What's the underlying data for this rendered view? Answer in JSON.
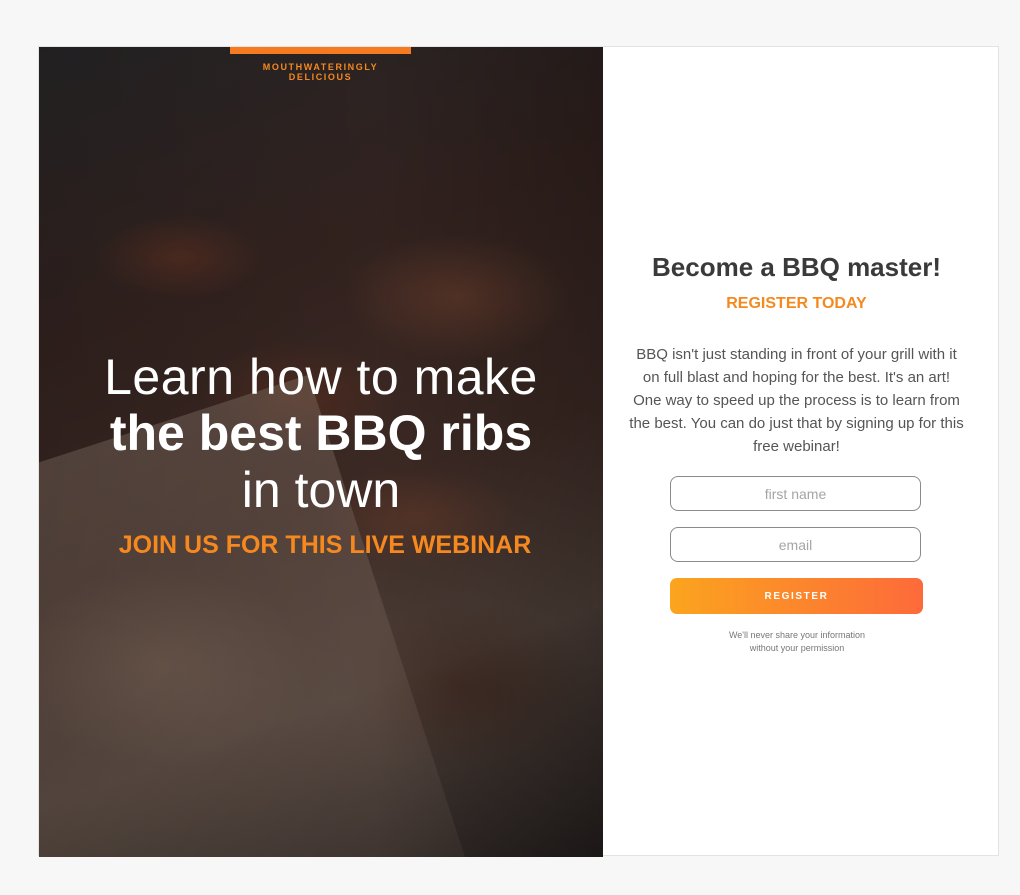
{
  "brand": {
    "tagline": "MOUTHWATERINGLY DELICIOUS",
    "accent_color": "#f5891f"
  },
  "hero": {
    "line1": "Learn how to make",
    "line2": "the best BBQ ribs",
    "line3": "in town",
    "cta_text": "JOIN US FOR THIS LIVE WEBINAR"
  },
  "form": {
    "title": "Become a BBQ master!",
    "subtitle": "REGISTER TODAY",
    "description": "BBQ isn't just standing in front of your grill with it on full blast and hoping for the best. It's an art! One way to speed up the process is to learn from the best. You can do just that by signing up for this free webinar!",
    "first_name_placeholder": "first name",
    "email_placeholder": "email",
    "submit_label": "REGISTER",
    "privacy_line1": "We'll never share your information",
    "privacy_line2": "without your permission",
    "button_gradient": [
      "#fba41e",
      "#fd6a3a"
    ]
  }
}
